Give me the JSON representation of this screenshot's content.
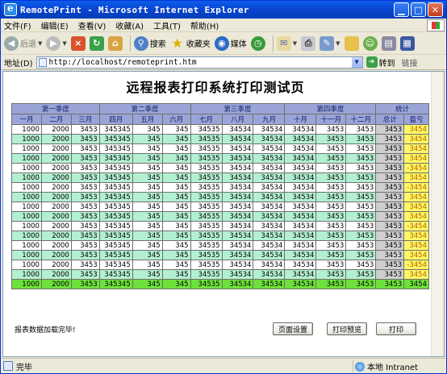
{
  "window": {
    "title": "RemotePrint - Microsoft Internet Explorer"
  },
  "menu": [
    "文件(F)",
    "编辑(E)",
    "查看(V)",
    "收藏(A)",
    "工具(T)",
    "帮助(H)"
  ],
  "toolbar": {
    "back": "后退",
    "search": "搜索",
    "favorites": "收藏夹",
    "media": "媒体"
  },
  "address": {
    "label": "地址(D)",
    "url": "http://localhost/remoteprint.htm",
    "go": "转到",
    "links": "链接"
  },
  "page": {
    "title": "远程报表打印系统打印测试页",
    "quarters": [
      "第一季度",
      "第二季度",
      "第三季度",
      "第四季度",
      "统计"
    ],
    "months": [
      "一月",
      "二月",
      "三月",
      "四月",
      "五月",
      "六月",
      "七月",
      "八月",
      "九月",
      "十月",
      "十一月",
      "十二月",
      "总计",
      "盈亏"
    ],
    "rows": [
      [
        "1000",
        "2000",
        "3453",
        "345345",
        "345",
        "345",
        "34535",
        "34534",
        "34534",
        "34534",
        "3453",
        "3453",
        "3453",
        "3454"
      ],
      [
        "1000",
        "2000",
        "3453",
        "345345",
        "345",
        "345",
        "34535",
        "34534",
        "34534",
        "34534",
        "3453",
        "3453",
        "3453",
        "3454"
      ],
      [
        "1000",
        "2000",
        "3453",
        "345345",
        "345",
        "345",
        "34535",
        "34534",
        "34534",
        "34534",
        "3453",
        "3453",
        "3453",
        "3454"
      ],
      [
        "1000",
        "2000",
        "3453",
        "345345",
        "345",
        "345",
        "34535",
        "34534",
        "34534",
        "34534",
        "3453",
        "3453",
        "3453",
        "3454"
      ],
      [
        "1000",
        "2000",
        "3453",
        "345345",
        "345",
        "345",
        "34535",
        "34534",
        "34534",
        "34534",
        "3453",
        "3453",
        "3453",
        "-3454"
      ],
      [
        "1000",
        "2000",
        "3453",
        "345345",
        "345",
        "345",
        "34535",
        "34534",
        "34534",
        "34534",
        "3453",
        "3453",
        "3453",
        "3454"
      ],
      [
        "1000",
        "2000",
        "3453",
        "345345",
        "345",
        "345",
        "34535",
        "34534",
        "34534",
        "34534",
        "3453",
        "3453",
        "3453",
        "-3454"
      ],
      [
        "1000",
        "2000",
        "3453",
        "345345",
        "345",
        "345",
        "34535",
        "34534",
        "34534",
        "34534",
        "3453",
        "3453",
        "3453",
        "3454"
      ],
      [
        "1000",
        "2000",
        "3453",
        "345345",
        "345",
        "345",
        "34535",
        "34534",
        "34534",
        "34534",
        "3453",
        "3453",
        "3453",
        "3454"
      ],
      [
        "1000",
        "2000",
        "3453",
        "345345",
        "345",
        "345",
        "34535",
        "34534",
        "34534",
        "34534",
        "3453",
        "3453",
        "3453",
        "3454"
      ],
      [
        "1000",
        "2000",
        "3453",
        "345345",
        "345",
        "345",
        "34535",
        "34534",
        "34534",
        "34534",
        "3453",
        "3453",
        "3453",
        "-3454"
      ],
      [
        "1000",
        "2000",
        "3453",
        "345345",
        "345",
        "345",
        "34535",
        "34534",
        "34534",
        "34534",
        "3453",
        "3453",
        "3453",
        "3454"
      ],
      [
        "1000",
        "2000",
        "3453",
        "345345",
        "345",
        "345",
        "34535",
        "34534",
        "34534",
        "34534",
        "3453",
        "3453",
        "3453",
        "3454"
      ],
      [
        "1000",
        "2000",
        "3453",
        "345345",
        "345",
        "345",
        "34535",
        "34534",
        "34534",
        "34534",
        "3453",
        "3453",
        "3453",
        "3454"
      ],
      [
        "1000",
        "2000",
        "3453",
        "345345",
        "345",
        "345",
        "34535",
        "34534",
        "34534",
        "34534",
        "3453",
        "3453",
        "3453",
        "-3454"
      ],
      [
        "1000",
        "2000",
        "3453",
        "345345",
        "345",
        "345",
        "34535",
        "34534",
        "34534",
        "34534",
        "3453",
        "3453",
        "3453",
        "3454"
      ]
    ],
    "total_row": [
      "1000",
      "2000",
      "3453",
      "345345",
      "345",
      "345",
      "34535",
      "34534",
      "34534",
      "34534",
      "3453",
      "3453",
      "3453",
      "3454"
    ],
    "load_status": "报表数据加载完毕!",
    "buttons": {
      "page_setup": "页面设置",
      "print_preview": "打印预览",
      "print": "打印"
    }
  },
  "statusbar": {
    "text": "完毕",
    "zone": "本地 Intranet"
  },
  "colors": {
    "header": "#9aa4d7",
    "row_alt": "#b3f0d2",
    "total_col": "#cfcfcf",
    "profit_col": "#fff766",
    "total_row": "#6ee13c"
  }
}
